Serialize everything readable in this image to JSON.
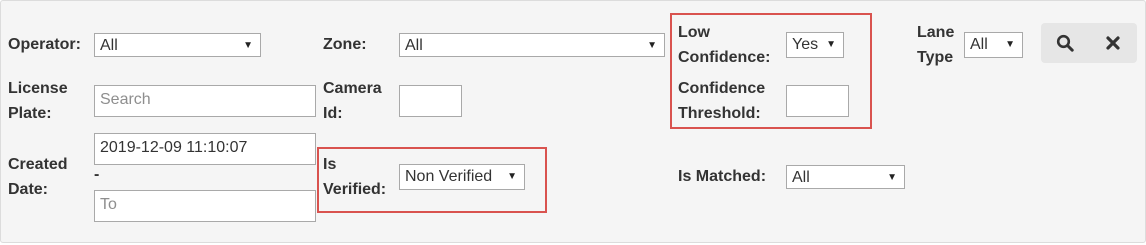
{
  "filters": {
    "operator": {
      "label": "Operator:",
      "value": "All"
    },
    "zone": {
      "label": "Zone:",
      "value": "All"
    },
    "low_confidence": {
      "label_line1": "Low",
      "label_line2": "Confidence:",
      "value": "Yes"
    },
    "lane_type": {
      "label_line1": "Lane",
      "label_line2": "Type",
      "value": "All"
    },
    "license_plate": {
      "label_line1": "License",
      "label_line2": "Plate:",
      "value": "",
      "placeholder": "Search"
    },
    "camera_id": {
      "label_line1": "Camera",
      "label_line2": "Id:",
      "value": ""
    },
    "confidence_threshold": {
      "label_line1": "Confidence",
      "label_line2": "Threshold:",
      "value": ""
    },
    "created_date": {
      "label_line1": "Created",
      "label_line2": "Date:",
      "from_value": "2019-12-09 11:10:07",
      "separator": "-",
      "to_value": "",
      "to_placeholder": "To"
    },
    "is_verified": {
      "label_line1": "Is",
      "label_line2": "Verified:",
      "value": "Non Verified"
    },
    "is_matched": {
      "label": "Is Matched:",
      "value": "All"
    }
  },
  "buttons": {
    "search_icon": "search-icon",
    "clear_icon": "close-icon"
  },
  "colors": {
    "highlight": "#d9534f",
    "panel_bg": "#f5f5f5",
    "button_bg": "#e6e6e6"
  }
}
